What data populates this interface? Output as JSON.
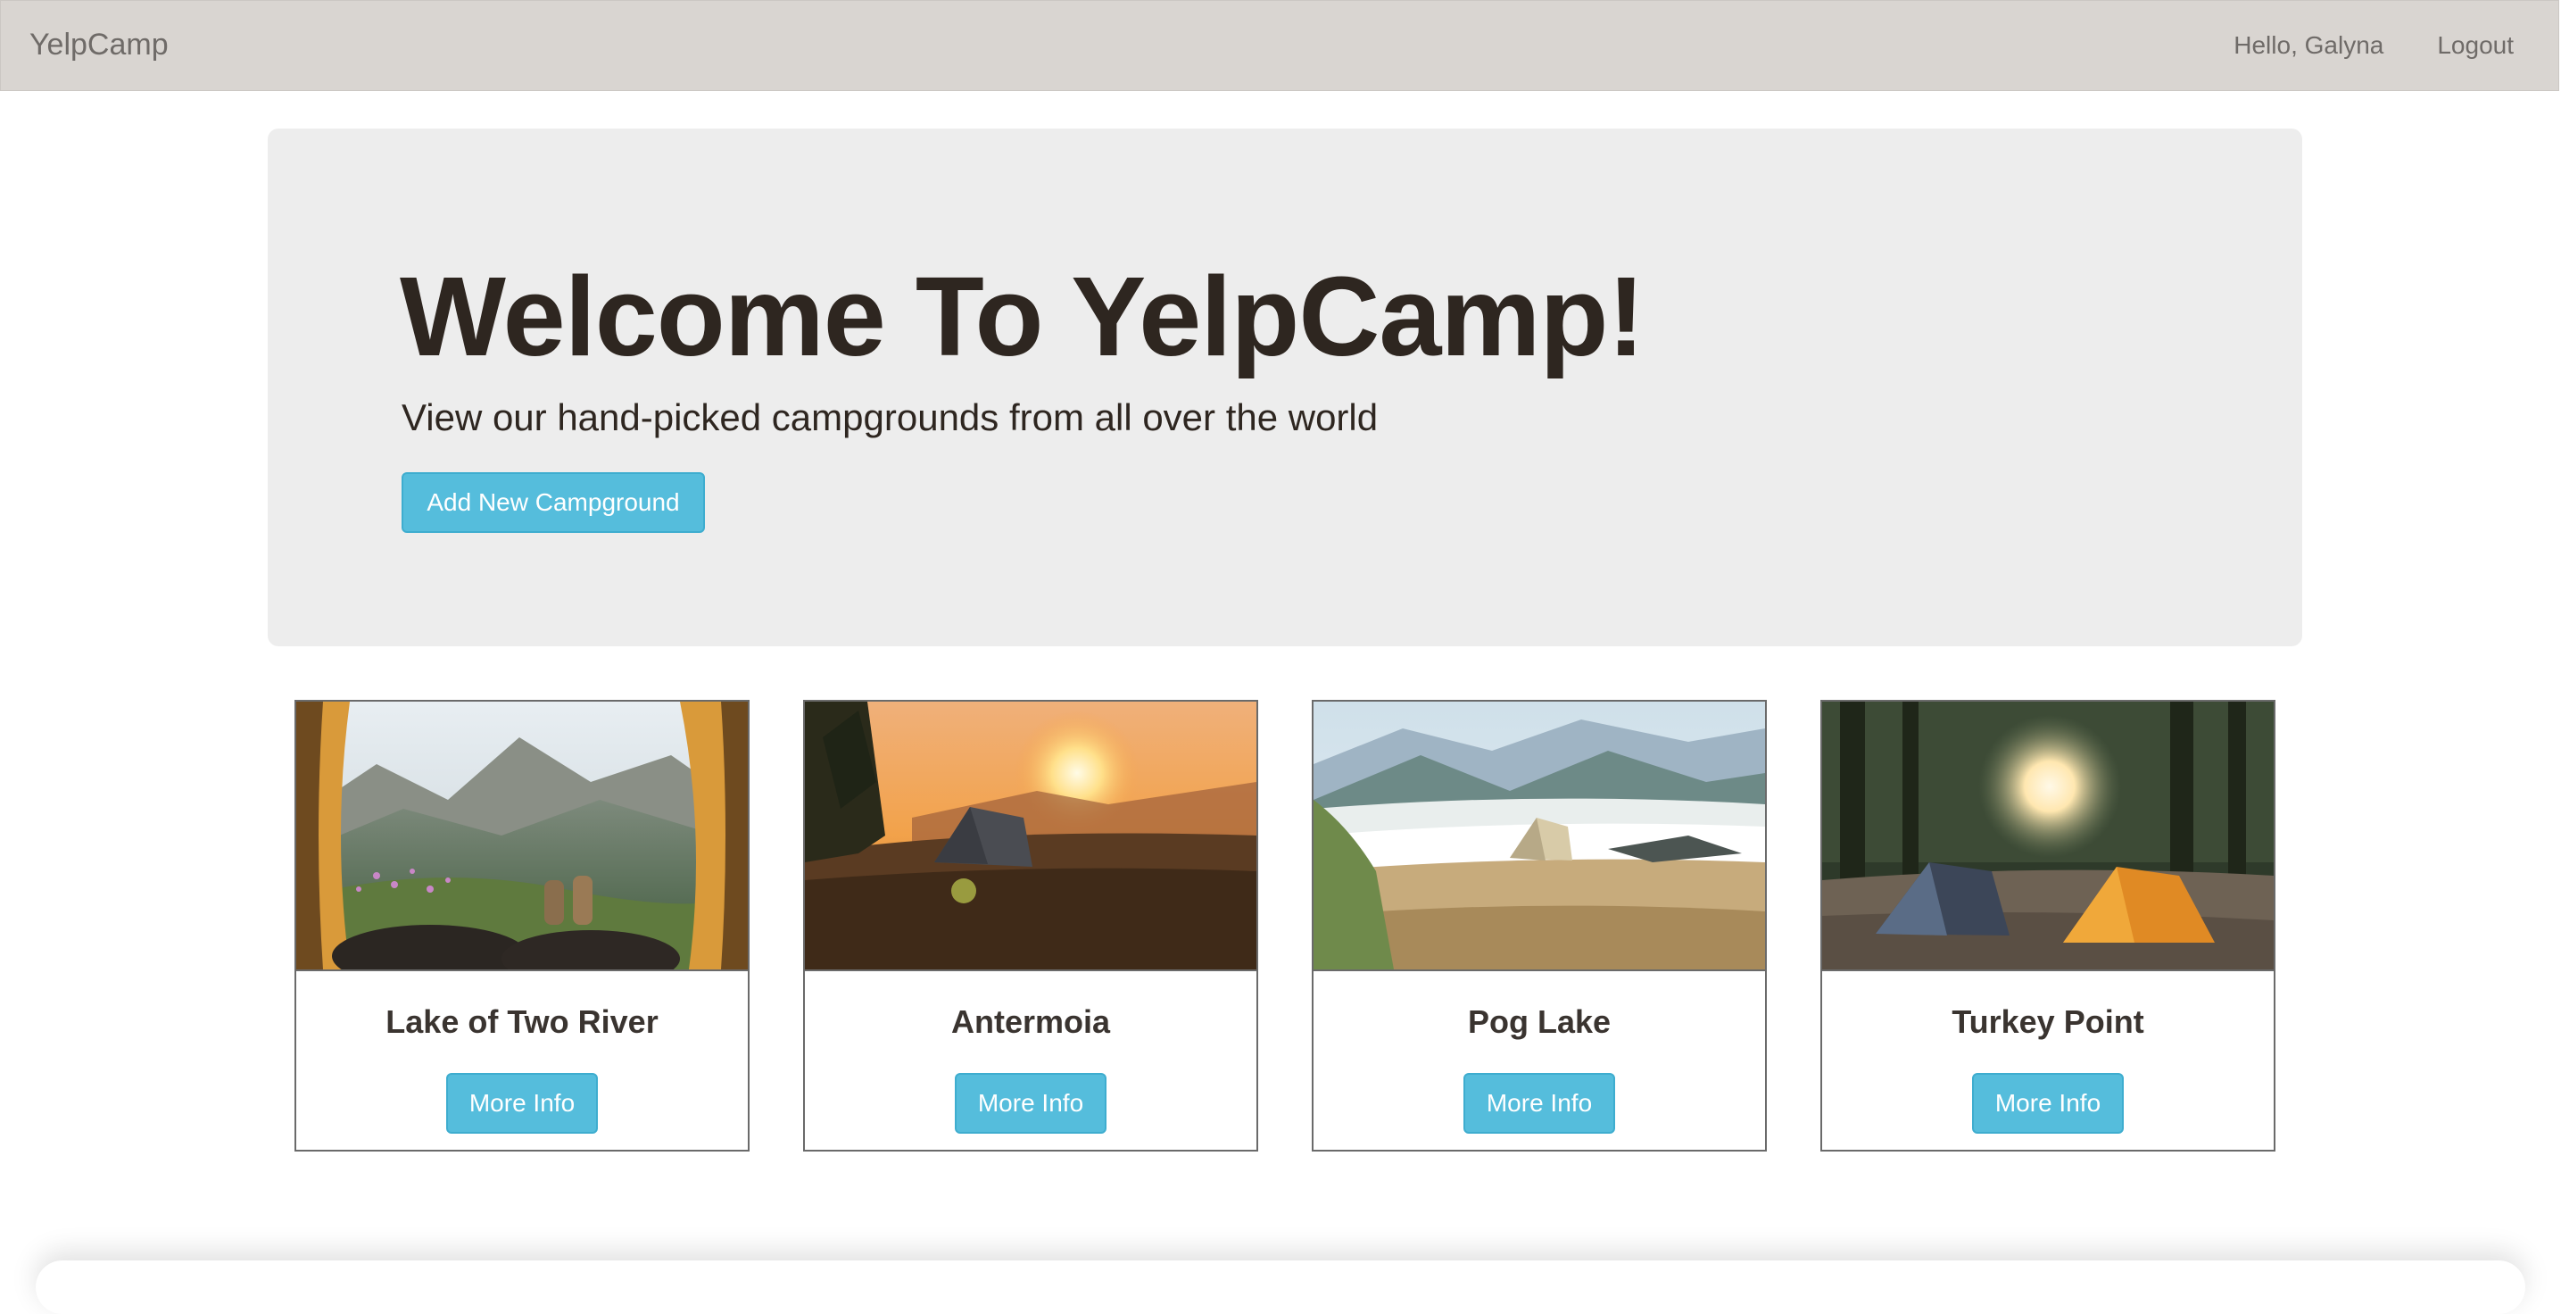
{
  "navbar": {
    "brand": "YelpCamp",
    "greeting": "Hello, Galyna",
    "logout": "Logout"
  },
  "jumbotron": {
    "title": "Welcome To YelpCamp!",
    "subtitle": "View our hand-picked campgrounds from all over the world",
    "add_button": "Add New Campground"
  },
  "campgrounds": [
    {
      "name": "Lake of Two River",
      "button": "More Info"
    },
    {
      "name": "Antermoia",
      "button": "More Info"
    },
    {
      "name": "Pog Lake",
      "button": "More Info"
    },
    {
      "name": "Turkey Point",
      "button": "More Info"
    }
  ],
  "colors": {
    "navbar_bg": "#d9d5d1",
    "jumbotron_bg": "#ededed",
    "button_info": "#55bddc",
    "heading_text": "#2e2620"
  }
}
